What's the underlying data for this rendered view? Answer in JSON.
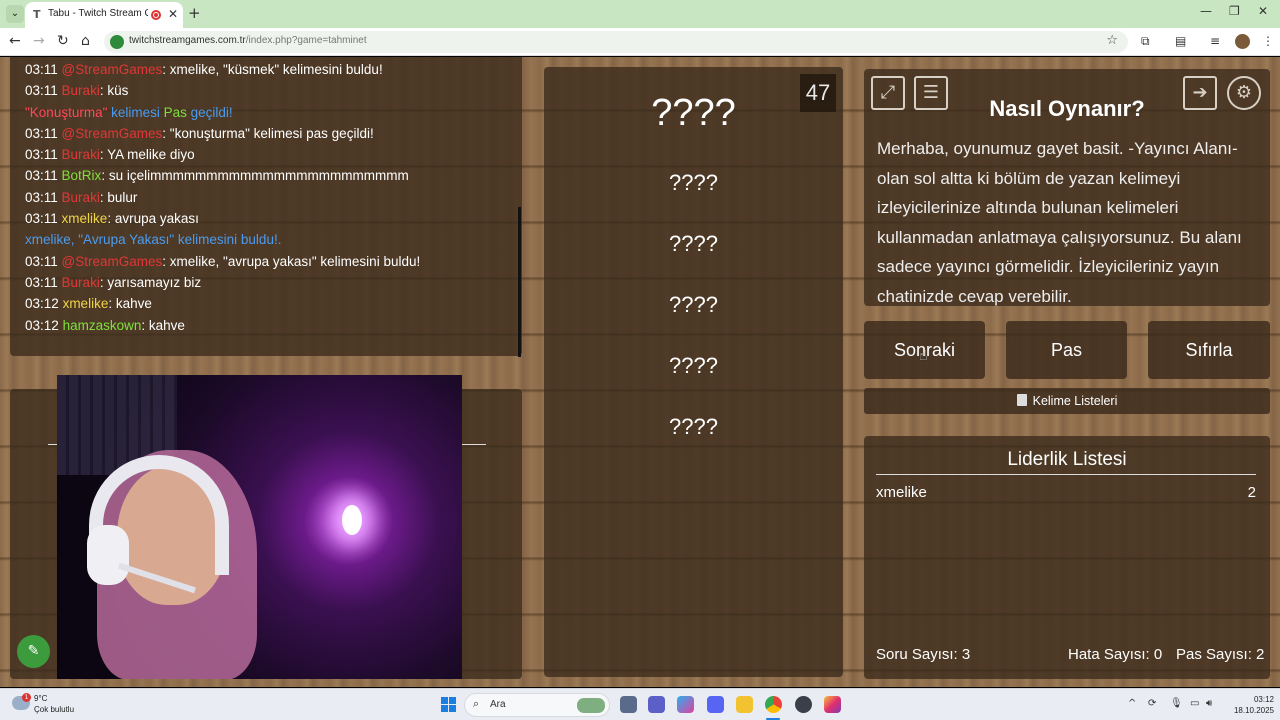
{
  "browser": {
    "tab_title": "Tabu - Twitch Stream Games",
    "url_host": "twitchstreamgames.com.tr",
    "url_path": "/index.php?game=tahminet"
  },
  "chat": {
    "lines": [
      {
        "time": "03:11",
        "user": "@StreamGames",
        "text": ": xmelike, \"küsmek\" kelimesini buldu!",
        "user_color": "#e03838"
      },
      {
        "time": "03:11",
        "user": "Buraki",
        "text": ": küs",
        "user_color": "#e03838"
      },
      {
        "prefix": "\"Konuşturma\"",
        "mid": " kelimesi ",
        "pas": "Pas",
        "text": " geçildi!"
      },
      {
        "time": "03:11",
        "user": "@StreamGames",
        "text": ": \"konuşturma\" kelimesi pas geçildi!",
        "user_color": "#e03838"
      },
      {
        "time": "03:11",
        "user": "Buraki",
        "text": ": YA melike diyo",
        "user_color": "#e03838"
      },
      {
        "time": "03:11",
        "user": "BotRix",
        "text": ": su içelimmmmmmmmmmmmmmmmmmmmmmm",
        "user_color": "#7ee03c"
      },
      {
        "time": "03:11",
        "user": "Buraki",
        "text": ": bulur",
        "user_color": "#e03838"
      },
      {
        "time": "03:11",
        "user": "xmelike",
        "text": ": avrupa yakası",
        "user_color": "#f0d448"
      },
      {
        "system": "xmelike, \"Avrupa Yakası\" kelimesini buldu!."
      },
      {
        "time": "03:11",
        "user": "@StreamGames",
        "text": ": xmelike, \"avrupa yakası\" kelimesini buldu!",
        "user_color": "#e03838"
      },
      {
        "time": "03:11",
        "user": "Buraki",
        "text": ": yarısamayız biz",
        "user_color": "#e03838"
      },
      {
        "time": "03:12",
        "user": "xmelike",
        "text": ": kahve",
        "user_color": "#f0d448"
      },
      {
        "time": "03:12",
        "user": "hamzaskown",
        "text": ": kahve",
        "user_color": "#7ee03c"
      }
    ]
  },
  "game": {
    "timer": "47",
    "main_word": "????",
    "taboo_words": [
      "????",
      "????",
      "????",
      "????",
      "????"
    ]
  },
  "howto": {
    "title": "Nasıl Oynanır?",
    "text": "Merhaba, oyunumuz gayet basit. -Yayıncı Alanı- olan sol altta ki bölüm de yazan kelimeyi izleyicilerinize altında bulunan kelimeleri kullanmadan anlatmaya çalışıyorsunuz. Bu alanı sadece yayıncı görmelidir. İzleyicileriniz yayın chatinizde cevap verebilir.",
    "icons": [
      "fullscreen-icon",
      "notes-icon",
      "exit-icon",
      "settings-icon"
    ]
  },
  "controls": {
    "next": "Sonraki",
    "pass": "Pas",
    "reset": "Sıfırla",
    "word_lists": "Kelime Listeleri"
  },
  "leaderboard": {
    "title": "Liderlik Listesi",
    "rows": [
      {
        "name": "xmelike",
        "score": "2"
      }
    ],
    "questions_label": "Soru Sayısı:",
    "questions_value": "3",
    "errors_label": "Hata Sayısı:",
    "errors_value": "0",
    "passes_label": "Pas Sayısı:",
    "passes_value": "2"
  },
  "taskbar": {
    "weather_temp": "9°C",
    "weather_desc": "Çok bulutlu",
    "weather_badge": "1",
    "search_placeholder": "Ara",
    "time": "03:12",
    "date": "18.10.2025"
  },
  "colors": {
    "panel": "#3a2a1b",
    "user_red": "#e03838",
    "user_green": "#7ee03c",
    "user_yellow": "#f0d448",
    "system_blue": "#4a9cf0"
  }
}
